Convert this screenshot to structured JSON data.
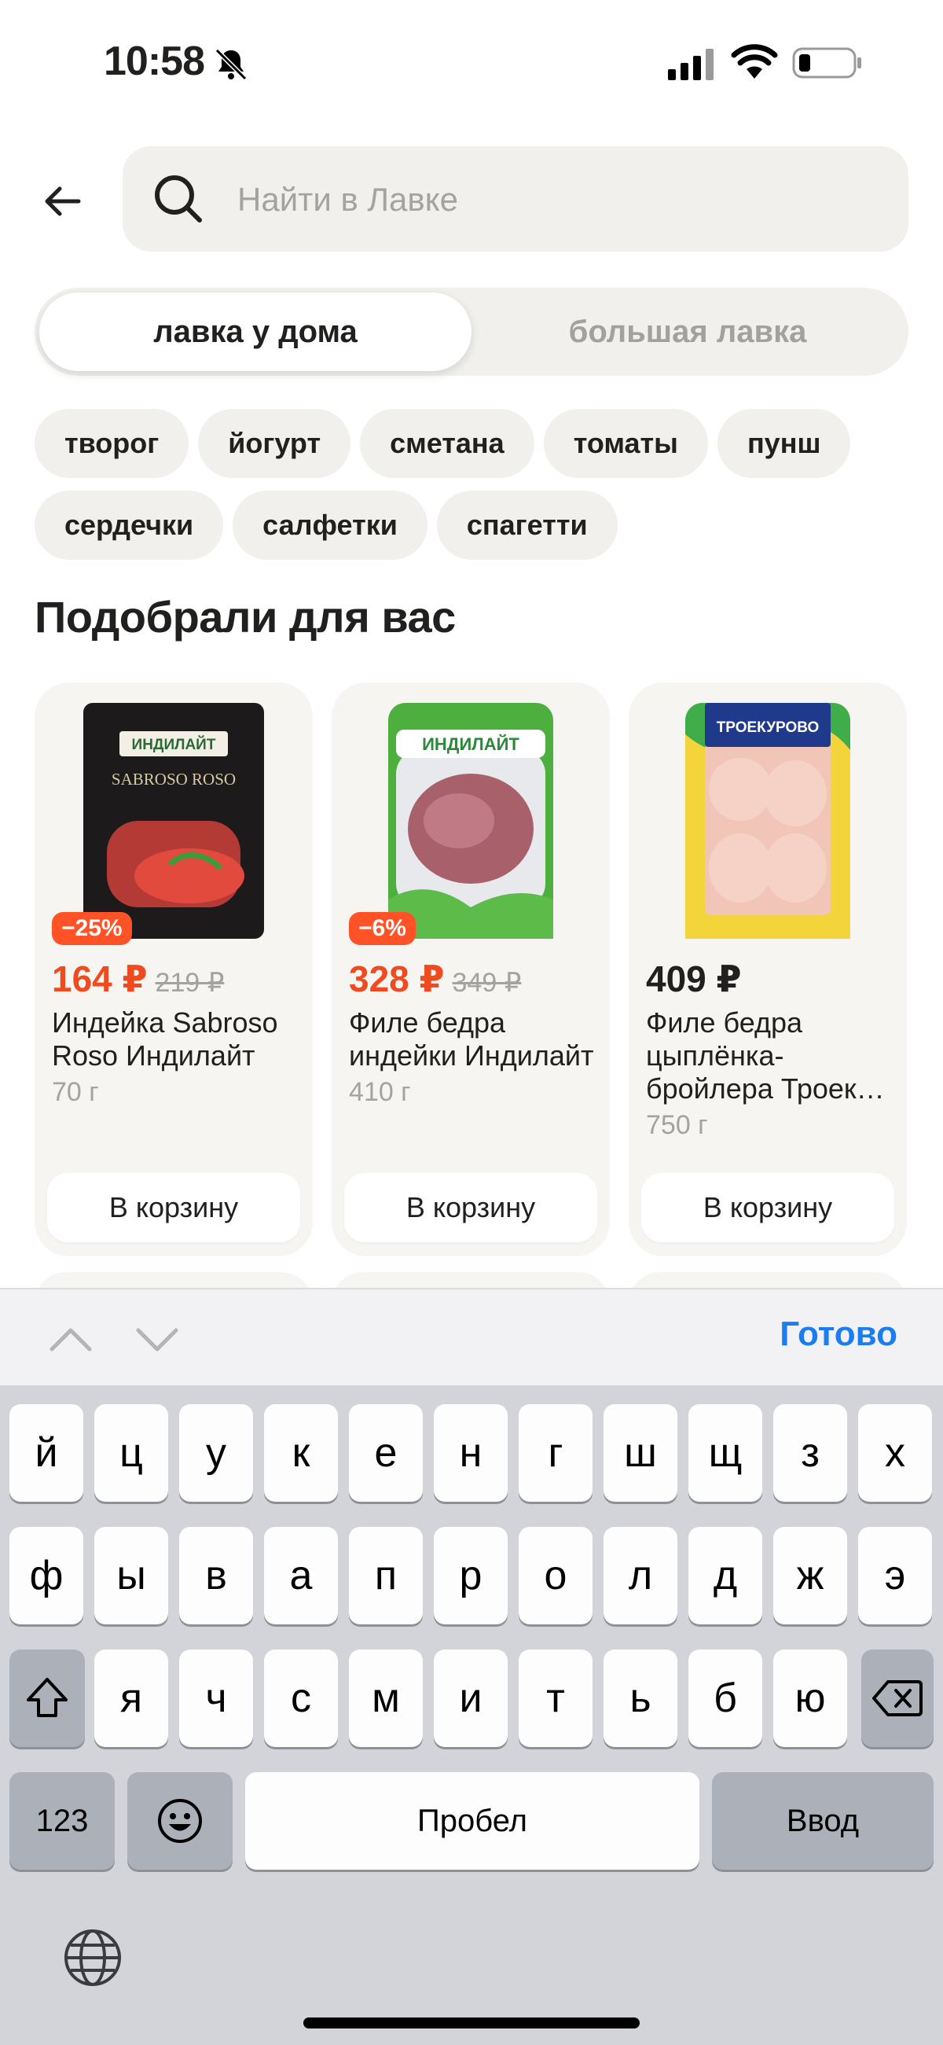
{
  "status_bar": {
    "time": "10:58"
  },
  "search": {
    "placeholder": "Найти в Лавке",
    "value": ""
  },
  "segments": [
    {
      "label": "лавка у дома",
      "active": true
    },
    {
      "label": "большая лавка",
      "active": false
    }
  ],
  "chips": {
    "row1": [
      "творог",
      "йогурт",
      "сметана",
      "томаты",
      "пунш"
    ],
    "row2": [
      "сердечки",
      "салфетки",
      "спагетти"
    ]
  },
  "section_title": "Подобрали для вас",
  "products": [
    {
      "discount": "−25%",
      "price": "164 ₽",
      "old_price": "219 ₽",
      "name": "Индейка Sabroso Roso Индилайт",
      "weight": "70 г",
      "cart_label": "В корзину",
      "brand": "ИНДИЛАЙТ",
      "subbrand": "SABROSO ROSO"
    },
    {
      "discount": "−6%",
      "price": "328 ₽",
      "old_price": "349 ₽",
      "name": "Филе бедра индейки Индилайт",
      "weight": "410 г",
      "cart_label": "В корзину",
      "brand": "ИНДИЛАЙТ"
    },
    {
      "discount": "",
      "price": "409 ₽",
      "old_price": "",
      "name": "Филе бедра цыплёнка-бройлера Троек…",
      "weight": "750 г",
      "cart_label": "В корзину",
      "brand": "ТРОЕКУРОВО"
    }
  ],
  "keyboard": {
    "done_label": "Готово",
    "row1": [
      "й",
      "ц",
      "у",
      "к",
      "е",
      "н",
      "г",
      "ш",
      "щ",
      "з",
      "х"
    ],
    "row2": [
      "ф",
      "ы",
      "в",
      "а",
      "п",
      "р",
      "о",
      "л",
      "д",
      "ж",
      "э"
    ],
    "row3": [
      "я",
      "ч",
      "с",
      "м",
      "и",
      "т",
      "ь",
      "б",
      "ю"
    ],
    "numbers_label": "123",
    "space_label": "Пробел",
    "return_label": "Ввод"
  },
  "colors": {
    "accent_blue": "#1a7df1",
    "sale_red": "#f04b1f",
    "badge": "#ff5226",
    "chip_bg": "#f1f0ed"
  },
  "icons": [
    "bell-slash-icon",
    "signal-icon",
    "wifi-icon",
    "battery-icon",
    "back-arrow-icon",
    "search-icon",
    "chevron-up-icon",
    "chevron-down-icon",
    "shift-icon",
    "backspace-icon",
    "emoji-icon",
    "globe-icon"
  ]
}
